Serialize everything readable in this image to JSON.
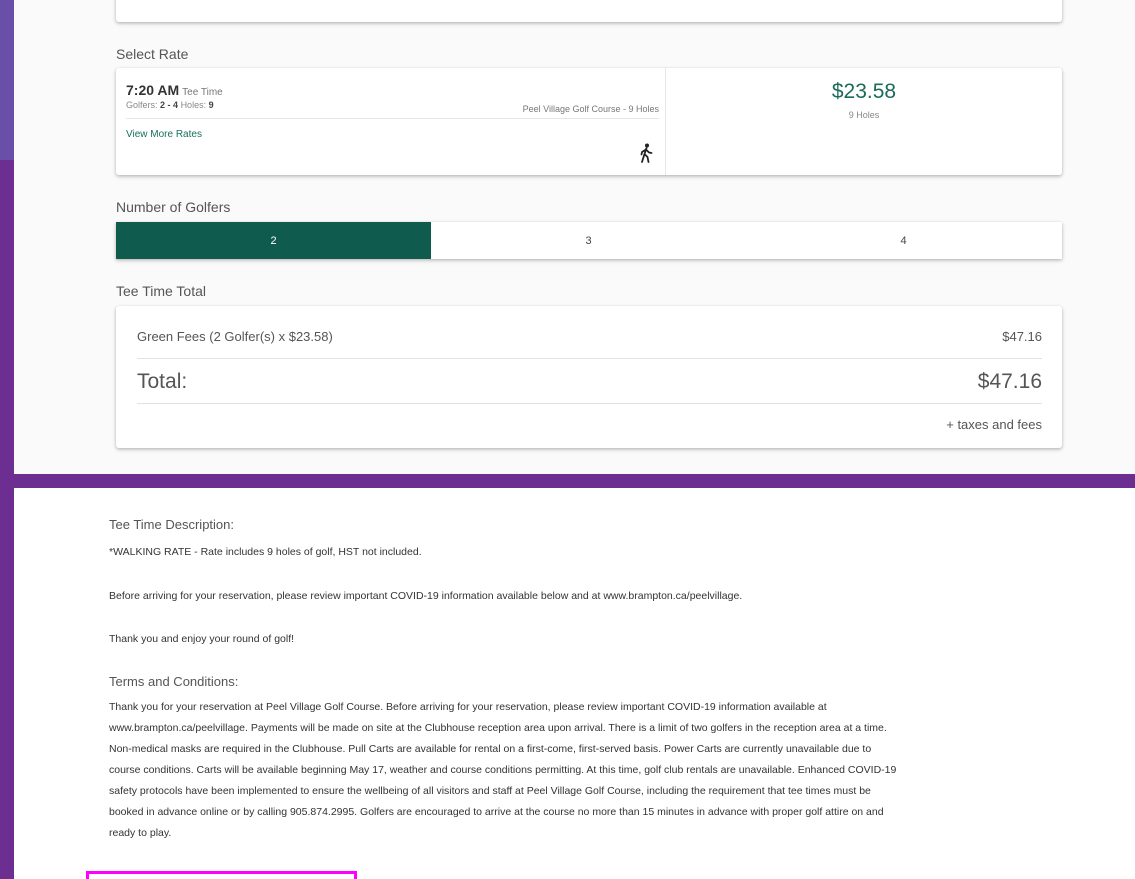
{
  "select_rate": {
    "heading": "Select Rate",
    "time": "7:20 AM",
    "time_suffix": "Tee Time",
    "golfers_label": "Golfers:",
    "golfers_range": "2 - 4",
    "holes_label": "Holes:",
    "holes_value": "9",
    "course": "Peel Village Golf Course - 9 Holes",
    "more_rates": "View More Rates",
    "icon": "walking-person-icon",
    "price": "$23.58",
    "price_holes": "9 Holes"
  },
  "golfers": {
    "heading": "Number of Golfers",
    "options": [
      "2",
      "3",
      "4"
    ],
    "selected": "2",
    "accent_color": "#0f5c4f"
  },
  "total": {
    "heading": "Tee Time Total",
    "fee_label": "Green Fees (2 Golfer(s) x $23.58)",
    "fee_amount": "$47.16",
    "total_label": "Total:",
    "total_amount": "$47.16",
    "taxes": "+ taxes and fees"
  },
  "description": {
    "heading": "Tee Time Description:",
    "p1": "*WALKING RATE - Rate includes 9 holes of golf, HST not included.",
    "p2": "Before arriving for your reservation, please review important COVID-19 information available below and at www.brampton.ca/peelvillage.",
    "p3": "Thank you and enjoy your round of golf!"
  },
  "terms": {
    "heading": "Terms and Conditions:",
    "lines": [
      "Thank you for your reservation at Peel Village Golf Course. Before arriving for your reservation, please review important COVID-19 information available at",
      "www.brampton.ca/peelvillage. Payments will be made on site at the Clubhouse reception area upon arrival. There is a limit of two golfers in the reception area at a time.",
      "Non-medical masks are required in the Clubhouse. Pull Carts are available for rental on a first-come, first-served basis. Power Carts are currently unavailable due to",
      "course conditions. Carts will be available beginning May 17, weather and course conditions permitting. At this time, golf club rentals are unavailable. Enhanced COVID-19",
      "safety protocols have been implemented to ensure the wellbeing of all visitors and staff at Peel Village Golf Course, including the requirement that tee times must be",
      "booked in advance online or by calling 905.874.2995. Golfers are encouraged to arrive at the course no more than 15 minutes in advance with proper golf attire on and",
      "ready to play."
    ]
  },
  "colors": {
    "frame_purple": "#6c2f91",
    "price_green": "#1a6b5a",
    "highlight_magenta": "#ff00ff"
  }
}
